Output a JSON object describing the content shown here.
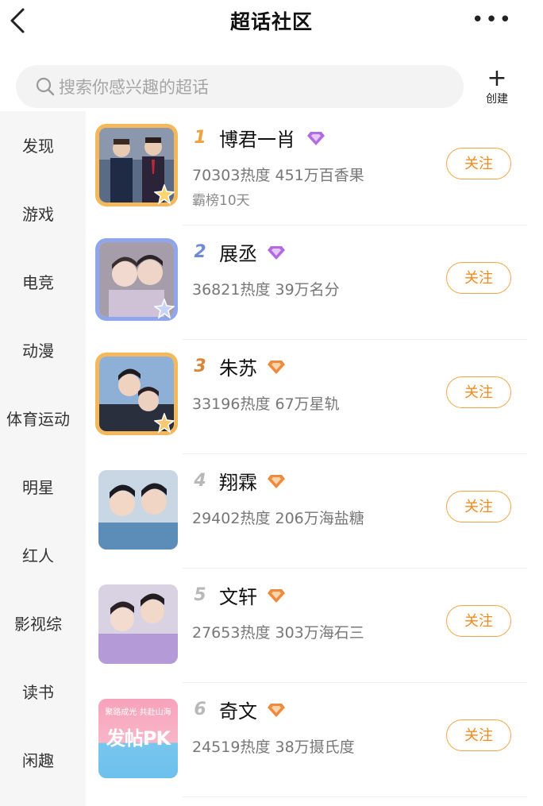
{
  "header": {
    "title": "超话社区",
    "back_icon": "chevron-left-icon",
    "more_icon": "more-dots-icon",
    "more_text": "•••"
  },
  "search": {
    "placeholder": "搜索你感兴趣的超话",
    "icon": "search-icon"
  },
  "create": {
    "plus": "+",
    "label": "创建"
  },
  "sidebar": {
    "items": [
      "发现",
      "游戏",
      "电竞",
      "动漫",
      "体育运动",
      "明星",
      "红人",
      "影视综",
      "读书",
      "闲趣"
    ]
  },
  "colors": {
    "accent": "#f08a1c",
    "gold": "#f4b85a",
    "silver_blue": "#8fa6ec",
    "badge_purple": "#b36be0",
    "badge_orange": "#ef8a3c"
  },
  "list": [
    {
      "rank": "1",
      "name": "博君一肖",
      "heat": "70303热度",
      "fans": "451万百香果",
      "extra": "霸榜10天",
      "follow": "关注",
      "badge": "purple-diamond-icon",
      "frame": "gold"
    },
    {
      "rank": "2",
      "name": "展丞",
      "heat": "36821热度",
      "fans": "39万名分",
      "follow": "关注",
      "badge": "purple-diamond-icon",
      "frame": "blue"
    },
    {
      "rank": "3",
      "name": "朱苏",
      "heat": "33196热度",
      "fans": "67万星轨",
      "follow": "关注",
      "badge": "orange-diamond-icon",
      "frame": "gold"
    },
    {
      "rank": "4",
      "name": "翔霖",
      "heat": "29402热度",
      "fans": "206万海盐糖",
      "follow": "关注",
      "badge": "orange-diamond-icon",
      "frame": "none"
    },
    {
      "rank": "5",
      "name": "文轩",
      "heat": "27653热度",
      "fans": "303万海石三",
      "follow": "关注",
      "badge": "orange-diamond-icon",
      "frame": "none"
    },
    {
      "rank": "6",
      "name": "奇文",
      "heat": "24519热度",
      "fans": "38万摄氏度",
      "follow": "关注",
      "badge": "orange-diamond-icon",
      "frame": "none",
      "avatar_text": "发帖PK",
      "avatar_subtext": "聚路成光 共赴山海"
    }
  ]
}
